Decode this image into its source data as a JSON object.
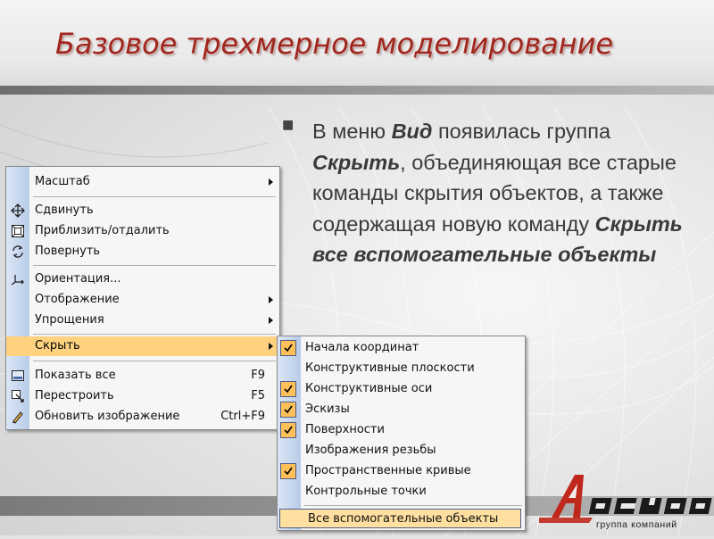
{
  "slide": {
    "title": "Базовое трехмерное моделирование",
    "bullet": {
      "part1": "В меню ",
      "em1": "Вид",
      "part2": " появилась группа ",
      "em2": "Скрыть",
      "part3": ", объединяющая все старые команды скрытия объектов, а также содержащая новую команду ",
      "em3": "Скрыть все вспомогательные объекты"
    }
  },
  "menu": {
    "items": [
      {
        "label": "Масштаб",
        "shortcut": "",
        "submenu": true,
        "icon": "none"
      },
      {
        "label": "Сдвинуть",
        "shortcut": "",
        "submenu": false,
        "icon": "move-arrows-icon"
      },
      {
        "label": "Приблизить/отдалить",
        "shortcut": "",
        "submenu": false,
        "icon": "zoom-box-icon"
      },
      {
        "label": "Повернуть",
        "shortcut": "",
        "submenu": false,
        "icon": "rotate-icon"
      },
      {
        "label": "Ориентация...",
        "shortcut": "",
        "submenu": false,
        "icon": "orientation-axes-icon"
      },
      {
        "label": "Отображение",
        "shortcut": "",
        "submenu": true,
        "icon": "none"
      },
      {
        "label": "Упрощения",
        "shortcut": "",
        "submenu": true,
        "icon": "none"
      },
      {
        "label": "Скрыть",
        "shortcut": "",
        "submenu": true,
        "icon": "none",
        "highlighted": true
      },
      {
        "label": "Показать все",
        "shortcut": "F9",
        "submenu": false,
        "icon": "show-all-icon"
      },
      {
        "label": "Перестроить",
        "shortcut": "F5",
        "submenu": false,
        "icon": "rebuild-icon"
      },
      {
        "label": "Обновить изображение",
        "shortcut": "Ctrl+F9",
        "submenu": false,
        "icon": "refresh-pen-icon"
      }
    ]
  },
  "submenu": {
    "items": [
      {
        "label": "Начала координат",
        "checked": true
      },
      {
        "label": "Конструктивные плоскости",
        "checked": false
      },
      {
        "label": "Конструктивные оси",
        "checked": true
      },
      {
        "label": "Эскизы",
        "checked": true
      },
      {
        "label": "Поверхности",
        "checked": true
      },
      {
        "label": "Изображения резьбы",
        "checked": false
      },
      {
        "label": "Пространственные кривые",
        "checked": true
      },
      {
        "label": "Контрольные точки",
        "checked": false
      },
      {
        "label": "Все вспомогательные объекты",
        "checked": false,
        "highlighted": true
      }
    ]
  },
  "logo": {
    "name": "АСКОН",
    "tagline": "группа компаний",
    "color": "#c0281c"
  },
  "colors": {
    "title": "#a2251d",
    "highlight": "#ffd280",
    "gutter": "#b8cce8"
  }
}
